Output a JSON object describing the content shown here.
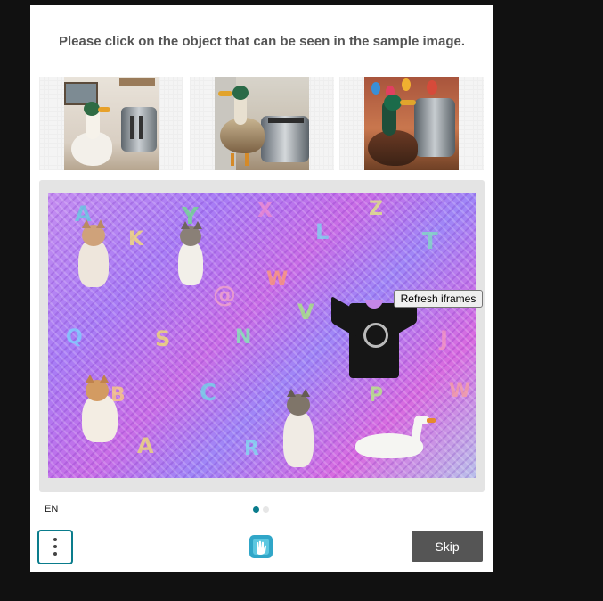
{
  "prompt": "Please click on the object that can be seen in the sample image.",
  "samples": [
    {
      "name": "sample-duck-toaster-1"
    },
    {
      "name": "sample-duck-toaster-2"
    },
    {
      "name": "sample-duck-toaster-3"
    }
  ],
  "challenge": {
    "objects": [
      "cat",
      "cat",
      "cat",
      "cat",
      "t-shirt",
      "swan"
    ]
  },
  "refresh_button": "Refresh iframes",
  "footer": {
    "language": "EN",
    "skip_label": "Skip",
    "menu_icon": "kebab-menu-icon",
    "logo_icon": "hcaptcha-hand-icon",
    "page_indicator": {
      "current": 1,
      "total": 2
    }
  },
  "colors": {
    "accent": "#0a7c8c",
    "skip_bg": "#555555",
    "page_bg": "#111111"
  }
}
